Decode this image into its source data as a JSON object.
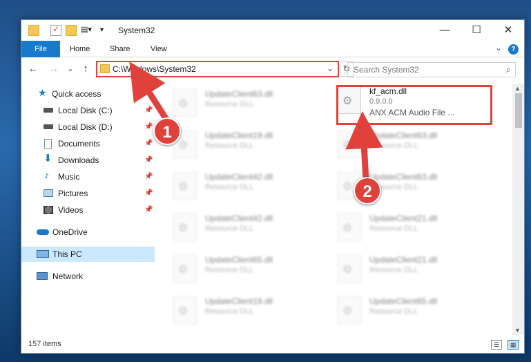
{
  "window": {
    "title": "System32",
    "minimize": "—",
    "maximize": "☐",
    "close": "✕"
  },
  "ribbon": {
    "file": "File",
    "home": "Home",
    "share": "Share",
    "view": "View",
    "help": "?",
    "collapse": "⌄"
  },
  "nav": {
    "back": "←",
    "forward": "→",
    "recent": "⌄",
    "up": "↑"
  },
  "address": {
    "path": "C:\\Windows\\System32",
    "dropdown": "⌄",
    "refresh": "↻"
  },
  "search": {
    "placeholder": "Search System32",
    "icon": "⌕"
  },
  "sidebar": {
    "items": [
      {
        "label": "Quick access",
        "icon": "star-icon"
      },
      {
        "label": "Local Disk (C:)",
        "icon": "drive-icon",
        "pin": "📌"
      },
      {
        "label": "Local Disk (D:)",
        "icon": "drive-icon",
        "pin": "📌"
      },
      {
        "label": "Documents",
        "icon": "documents-icon",
        "pin": "📌"
      },
      {
        "label": "Downloads",
        "icon": "downloads-icon",
        "pin": "📌"
      },
      {
        "label": "Music",
        "icon": "music-icon",
        "pin": "📌"
      },
      {
        "label": "Pictures",
        "icon": "pictures-icon",
        "pin": "📌"
      },
      {
        "label": "Videos",
        "icon": "videos-icon",
        "pin": "📌"
      },
      {
        "label": "OneDrive",
        "icon": "cloud-icon"
      },
      {
        "label": "This PC",
        "icon": "computer-icon"
      },
      {
        "label": "Network",
        "icon": "network-icon"
      }
    ]
  },
  "files": {
    "highlighted": {
      "name": "kf_acm.dll",
      "version": "0.9.0.0",
      "description": "ANX ACM Audio File ..."
    },
    "col1": [
      {
        "name": "UpdateClient63.dll",
        "type": "Resource DLL"
      },
      {
        "name": "UpdateClient19.dll",
        "type": "Resource DLL"
      },
      {
        "name": "UpdateClient42.dll",
        "type": "Resource DLL"
      },
      {
        "name": "UpdateClient42.dll",
        "type": "Resource DLL"
      },
      {
        "name": "UpdateClient65.dll",
        "type": "Resource DLL"
      },
      {
        "name": "UpdateClient19.dll",
        "type": "Resource DLL"
      }
    ],
    "col2": [
      {
        "name": "UpdateClient63.dll",
        "type": "Resource DLL"
      },
      {
        "name": "UpdateClient63.dll",
        "type": "Resource DLL"
      },
      {
        "name": "UpdateClient21.dll",
        "type": "Resource DLL"
      },
      {
        "name": "UpdateClient21.dll",
        "type": "Resource DLL"
      },
      {
        "name": "UpdateClient65.dll",
        "type": "Resource DLL"
      }
    ]
  },
  "status": {
    "count": "157 items"
  },
  "annotations": {
    "step1": "1",
    "step2": "2"
  },
  "colors": {
    "accent": "#1979ca",
    "annotation": "#e0413b",
    "selected": "#cce8ff"
  }
}
